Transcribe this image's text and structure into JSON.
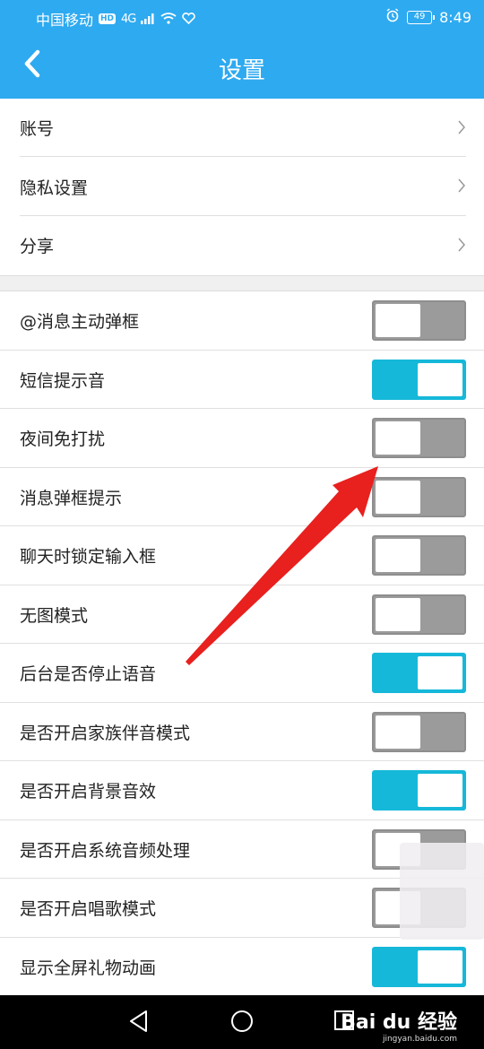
{
  "status_bar": {
    "carrier": "中国移动",
    "hd": "HD",
    "network": "4G",
    "battery": "49",
    "time": "8:49"
  },
  "header": {
    "title": "设置",
    "back_icon": "chevron-left-icon"
  },
  "menu": [
    {
      "label": "账号"
    },
    {
      "label": "隐私设置"
    },
    {
      "label": "分享"
    }
  ],
  "settings": [
    {
      "label": "@消息主动弹框",
      "enabled": false
    },
    {
      "label": "短信提示音",
      "enabled": true
    },
    {
      "label": "夜间免打扰",
      "enabled": false
    },
    {
      "label": "消息弹框提示",
      "enabled": false
    },
    {
      "label": "聊天时锁定输入框",
      "enabled": false
    },
    {
      "label": "无图模式",
      "enabled": false
    },
    {
      "label": "后台是否停止语音",
      "enabled": true
    },
    {
      "label": "是否开启家族伴音模式",
      "enabled": false
    },
    {
      "label": "是否开启背景音效",
      "enabled": true
    },
    {
      "label": "是否开启系统音频处理",
      "enabled": false
    },
    {
      "label": "是否开启唱歌模式",
      "enabled": false
    },
    {
      "label": "显示全屏礼物动画",
      "enabled": true
    }
  ],
  "colors": {
    "accent": "#2eaaf0",
    "toggle_on": "#16b8d9",
    "toggle_off": "#9b9b9b",
    "arrow": "#e8201e"
  },
  "watermark": {
    "brand": "Bai du 经验",
    "url": "jingyan.baidu.com"
  }
}
